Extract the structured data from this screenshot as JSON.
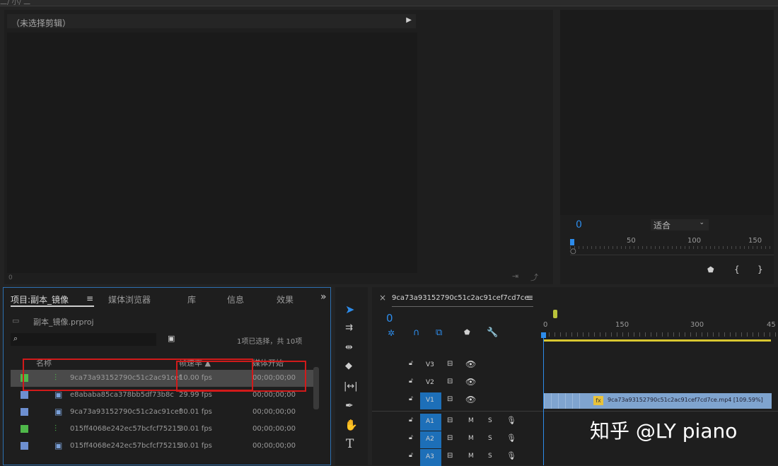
{
  "top_strip": {
    "text": "二/ 小/ 二"
  },
  "source_monitor": {
    "title": "（未选择剪辑）",
    "timecode_left": "0"
  },
  "program_monitor": {
    "timecode": "0",
    "zoom_select": "适合",
    "ruler_labels": [
      "50",
      "100",
      "150"
    ]
  },
  "project_panel": {
    "tabs": [
      "项目:副本_镜像",
      "媒体浏览器",
      "库",
      "信息",
      "效果"
    ],
    "menu_glyph": "≡",
    "more_glyph": "»",
    "file_name": "副本_镜像.prproj",
    "selection_status": "1项已选择，共 10项",
    "columns": [
      "名称",
      "帧速率 ▲",
      "媒体开始"
    ],
    "rows": [
      {
        "name": "9ca73a93152790c51c2ac91cef",
        "fps": "10.00 fps",
        "start": "00;00;00;00",
        "swatch": "#4fb84a",
        "icon": "sequence-icon",
        "selected": true
      },
      {
        "name": "e8ababa85ca378bb5df73b8c",
        "fps": "29.99 fps",
        "start": "00;00;00;00",
        "swatch": "#6d8fd0",
        "icon": "video-clip-icon",
        "selected": false
      },
      {
        "name": "9ca73a93152790c51c2ac91cef",
        "fps": "30.01 fps",
        "start": "00;00;00;00",
        "swatch": "#6d8fd0",
        "icon": "video-clip-icon",
        "selected": false
      },
      {
        "name": "015ff4068e242ec57bcfcf75215",
        "fps": "30.01 fps",
        "start": "00;00;00;00",
        "swatch": "#4fb84a",
        "icon": "sequence-icon",
        "selected": false
      },
      {
        "name": "015ff4068e242ec57bcfcf75215",
        "fps": "30.01 fps",
        "start": "00;00;00;00",
        "swatch": "#6d8fd0",
        "icon": "video-clip-icon",
        "selected": false
      }
    ]
  },
  "timeline": {
    "sequence_name": "9ca73a93152790c51c2ac91cef7cd7ce",
    "close_glyph": "×",
    "menu_glyph": "≡",
    "timecode": "0",
    "ruler_labels": [
      "0",
      "150",
      "300",
      "45"
    ],
    "tracks": [
      {
        "name": "V3",
        "type": "video"
      },
      {
        "name": "V2",
        "type": "video"
      },
      {
        "name": "V1",
        "type": "video"
      },
      {
        "name": "A1",
        "type": "audio"
      },
      {
        "name": "A2",
        "type": "audio"
      },
      {
        "name": "A3",
        "type": "audio"
      }
    ],
    "clip_label": "9ca73a93152790c51c2ac91cef7cd7ce.mp4 [109.59%]",
    "fx_badge": "fx",
    "mute_label": "M",
    "solo_label": "S"
  },
  "watermark": {
    "text": "知乎 @LY piano"
  },
  "colors": {
    "accent_blue": "#2d8ceb",
    "track_target_blue": "#1d6fb8",
    "clip_blue": "#7fa4cf",
    "highlight_red": "#d11a1a",
    "work_area_yellow": "#d8c630"
  }
}
